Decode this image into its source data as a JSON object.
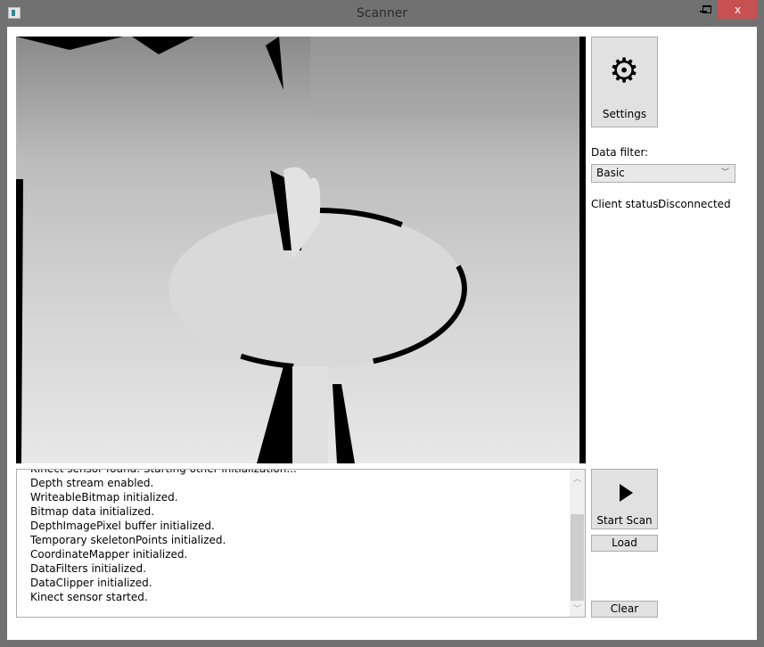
{
  "window": {
    "title": "Scanner",
    "minimize": "_",
    "maximize": "□",
    "close": "x",
    "close_color": "#c75050"
  },
  "settings_button": {
    "label": "Settings",
    "icon": "gear-icon"
  },
  "data_filter": {
    "label": "Data filter:",
    "selected": "Basic"
  },
  "client_status": {
    "label": "Client status:",
    "value": "Disconnected"
  },
  "log": {
    "lines": [
      "Kinect sensor found. Starting other initialization...",
      "Depth stream enabled.",
      "WriteableBitmap initialized.",
      "Bitmap data initialized.",
      "DepthImagePixel buffer initialized.",
      "Temporary skeletonPoints initialized.",
      "CoordinateMapper initialized.",
      "DataFilters initialized.",
      "DataClipper initialized.",
      "Kinect sensor started."
    ]
  },
  "buttons": {
    "start_scan": "Start Scan",
    "load": "Load",
    "clear": "Clear"
  }
}
